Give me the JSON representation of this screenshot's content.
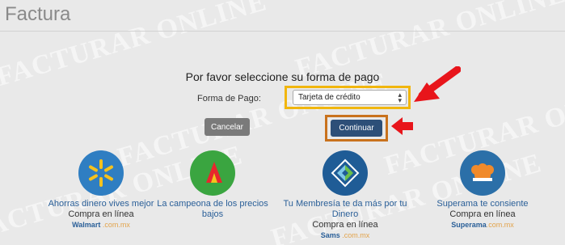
{
  "page": {
    "title": "Factura"
  },
  "watermark": {
    "text": "FACTURAR ONLINE"
  },
  "payment": {
    "heading": "Por favor seleccione su forma de pago",
    "label": "Forma de Pago:",
    "selected": "Tarjeta de crédito"
  },
  "buttons": {
    "cancel": "Cancelar",
    "continue": "Continuar"
  },
  "colors": {
    "select_highlight": "#f1b60e",
    "continue_highlight": "#c9721d",
    "arrow": "#e8151b",
    "continue_button": "#2d4f78",
    "cancel_button": "#7a7a7a"
  },
  "promos": [
    {
      "title": "Ahorras dinero vives mejor",
      "subtitle": "Compra en línea",
      "brand_main": "Walmart",
      "brand_suffix": ".com.mx",
      "icon": "walmart-spark-icon",
      "color": "#2f7ec2"
    },
    {
      "title": "La campeona de los precios bajos",
      "subtitle": "",
      "brand_main": "",
      "brand_suffix": "",
      "icon": "bodega-aurrera-icon",
      "color": "#3aa540"
    },
    {
      "title": "Tu Membresía te da más por tu Dinero",
      "subtitle": "Compra en línea",
      "brand_main": "Sams",
      "brand_suffix": ".com.mx",
      "icon": "sams-club-icon",
      "color": "#1f5c96"
    },
    {
      "title": "Superama te consiente",
      "subtitle": "Compra en línea",
      "brand_main": "Superama",
      "brand_suffix": ".com.mx",
      "icon": "superama-icon",
      "color": "#2b6fa8"
    }
  ]
}
